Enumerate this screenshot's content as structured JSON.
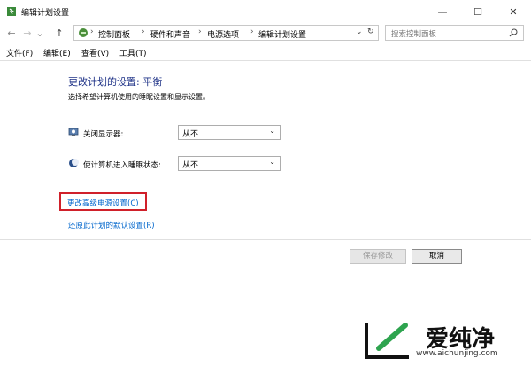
{
  "window": {
    "title": "编辑计划设置",
    "minimize": "—",
    "maximize": "☐",
    "close": "✕"
  },
  "nav": {
    "back": "←",
    "forward": "→",
    "dropdown": "⌄",
    "up": "↑",
    "breadcrumbs": [
      "控制面板",
      "硬件和声音",
      "电源选项",
      "编辑计划设置"
    ],
    "sep": "›",
    "refresh": "↻",
    "search_placeholder": "搜索控制面板"
  },
  "menu": {
    "items": [
      "文件(F)",
      "编辑(E)",
      "查看(V)",
      "工具(T)"
    ]
  },
  "content": {
    "heading": "更改计划的设置: 平衡",
    "subtitle": "选择希望计算机使用的睡眠设置和显示设置。",
    "display_off_label": "关闭显示器:",
    "display_off_value": "从不",
    "sleep_label": "使计算机进入睡眠状态:",
    "sleep_value": "从不",
    "advanced_link": "更改高级电源设置(C)",
    "restore_link": "还原此计划的默认设置(R)"
  },
  "footer": {
    "save_label": "保存修改",
    "cancel_label": "取消"
  },
  "watermark": {
    "brand": "爱纯净",
    "url": "www.aichunjing.com"
  },
  "colors": {
    "heading": "#1e3287",
    "link": "#0066cc",
    "highlight_box": "#d0202a"
  }
}
